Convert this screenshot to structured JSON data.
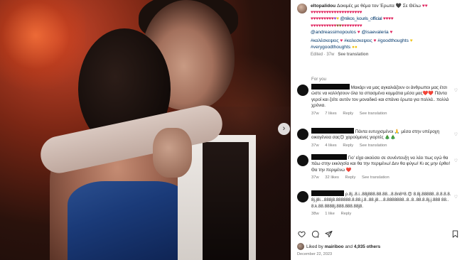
{
  "caption": {
    "username": "eltopalidou",
    "text": "Δοκιμές με θέμα τον Έρωτα 🖤 Σε Θέλω",
    "emoji_line_1": "♥♥♥♥♥♥♥♥♥♥♥♥♥♥♥♥♥♥♥♥",
    "emoji_line_2": "♥♥♥♥♥♥♥♥♥♥♥♥♥♥♥♥♥♥♥♥",
    "mention_1": "@nikos_kouris_official",
    "mention_2": "@andreassimopoulos",
    "mention_3": "@isaevaleria",
    "hashtag_1": "#καλέσκεψεις",
    "hashtag_2": "#καλεσκεψεις",
    "hashtag_3": "#goodthoughts",
    "hashtag_4": "#verygoodthoughts",
    "meta_time": "Edited · 37w",
    "see_translation": "See translation"
  },
  "for_you_label": "For you",
  "comments": [
    {
      "text": "Μακάρι να μας αγκαλιάζουν οι άνθρωποι μας έτσι ώστε να κολλήσουν όλα τα σπασμένα κομμάτια μέσα μας❤️❤️ Πάντα γεροί και ζείτε αυτόν τον μοναδικό και σπάνιο έρωτα για πολλά.. πολλά χρόνια.",
      "time": "37w",
      "likes": "7 likes",
      "reply": "Reply",
      "translate": "See translation"
    },
    {
      "text": "Πάντα ευτυχισμένοι 🙏 μέσα στην υπέροχη οικογένεια σας😊 χαρούμενες γιορτές 🎄🎄",
      "time": "37w",
      "likes": "4 likes",
      "reply": "Reply",
      "translate": "See translation"
    },
    {
      "text": "Γιο' είχα ακούσει σε συνέντευξη να λέει πως εγώ θα πάω στην εκκλησία και θα την περιμένω! Δεν θα φύγω! Κι ας μην έρθει! Θα την περιμένω ❤️",
      "time": "37w",
      "likes": "32 likes",
      "reply": "Reply",
      "translate": "See translation"
    },
    {
      "text": "ρ.8j..8.i..88j888.88.88...8.8n8⁸8.😍 8.8j.88888..8.8.8.8.8j.j8i...888j8.888888.8.88.j.8..88.j8....8.8888888..8..8..88.8.8j.j.888 88..8.k.88.8888j.888.888.88j8.",
      "time": "38w",
      "likes": "1 like",
      "reply": "Reply",
      "translate": ""
    }
  ],
  "likes": {
    "prefix": "Liked by",
    "user": "mairiboo",
    "middle": "and",
    "count": "4,935 others"
  },
  "date": "December 22, 2023",
  "icons": {
    "like": "heart-outline-icon",
    "comment": "comment-bubble-icon",
    "share": "paper-plane-icon",
    "save": "bookmark-icon",
    "next": "chevron-right-icon"
  }
}
